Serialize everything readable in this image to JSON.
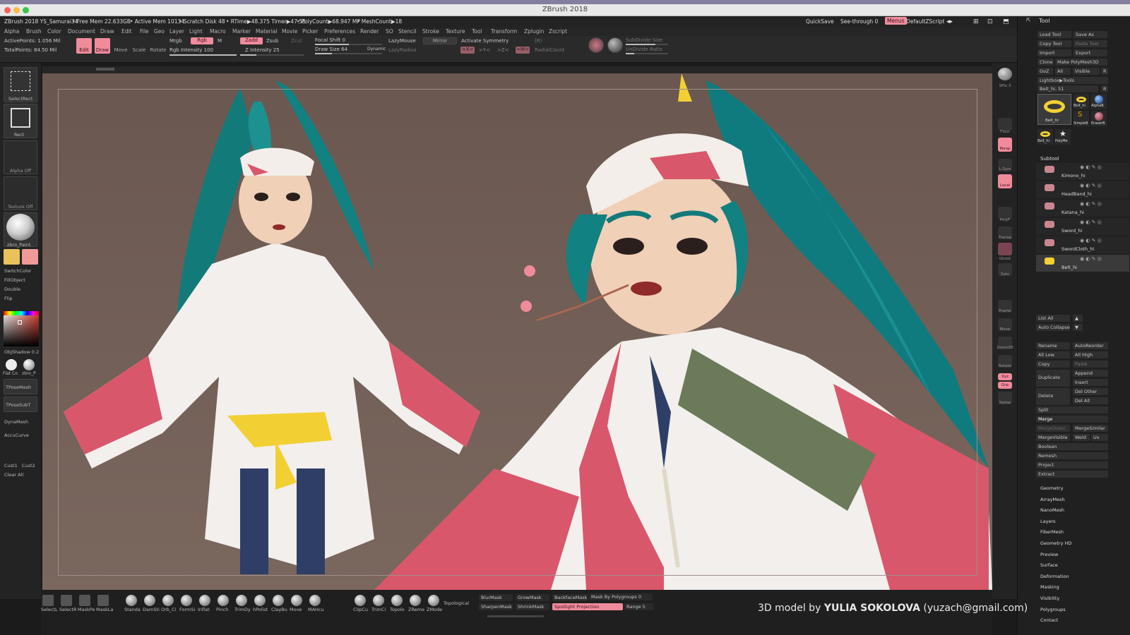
{
  "window": {
    "title": "ZBrush 2018"
  },
  "status": {
    "file": "ZBrush 2018 YS_Samurai34",
    "free_mem": "• Free Mem 22.633GB",
    "active_mem": "• Active Mem 10134",
    "scratch": "• Scratch Disk 48",
    "rtime": "• RTime▶48.375 Timer▶47.55",
    "polycount": "• PolyCount▶68.947 MP",
    "meshcount": "• MeshCount▶18",
    "quicksave": "QuickSave",
    "seethrough": "See-through  0",
    "menus": "Menus",
    "zscript": "DefaultZScript"
  },
  "menubar": [
    "Alpha",
    "Brush",
    "Color",
    "Document",
    "Draw",
    "Edit",
    "File",
    "Geo",
    "Layer",
    "Light",
    "Macro",
    "Marker",
    "Material",
    "Movie",
    "Picker",
    "Preferences",
    "Render",
    "SO",
    "Stencil",
    "Stroke",
    "Texture",
    "Tool",
    "Transform",
    "Zplugin",
    "Zscript"
  ],
  "shelf": {
    "active_points": "ActivePoints: 1.056 Mil",
    "total_points": "TotalPoints: 84.50 Mil",
    "edit": "Edit",
    "draw": "Draw",
    "move": "Move",
    "scale": "Scale",
    "rotate": "Rotate",
    "mrgb": "Mrgb",
    "rgb": "Rgb",
    "m": "M",
    "rgb_intensity": "Rgb Intensity 100",
    "zadd": "Zadd",
    "zsub": "Zsub",
    "zcut": "Zcut",
    "z_intensity": "Z Intensity 25",
    "focal_shift": "Focal Shift 0",
    "draw_size": "Draw Size 64",
    "dynamic": "Dynamic",
    "lazymouse": "LazyMouse",
    "lazyradius": "LazyRadius",
    "mirror": "Mirror",
    "activate_symmetry": "Activate Symmetry",
    "sym_x": ">X<",
    "sym_y": ">Y<",
    "sym_z": ">Z<",
    "sym_m": ">M<",
    "sym_r": "(R)",
    "radialcount": "RadialCount",
    "subdivide_size": "SubDivide Size",
    "undivide_ratio": "UnDivide Ratio"
  },
  "left": {
    "selectrect": "SelectRect",
    "rect": "Rect",
    "alpha_off": "Alpha Off",
    "texture_off": "Texture Off",
    "material": "zbro_Paint",
    "switchcolor": "SwitchColor",
    "fillobject": "FillObject",
    "double": "Double",
    "flip": "Flip",
    "objshadow": "ObjShadow  0.2",
    "flatco": "Flat Co",
    "zbro_p": "zbro_P",
    "tposemesh": "TPoseMesh",
    "tposesubt": "TPoseSubT",
    "dynamesh": "DynaMesh",
    "accucurve": "AccuCurve",
    "cust1": "Cust1",
    "cust2": "Cust2",
    "clearall": "Clear All",
    "primary_color": "#e9c35a",
    "secondary_color": "#ee9a98"
  },
  "right": {
    "bpr": "BPR",
    "spix": "SPix 3",
    "floor": "Floor",
    "persp": "Persp",
    "lsym": "L.Sym",
    "local": "Local",
    "polyf": "PolyF",
    "transp": "Transp",
    "ghost": "Ghost",
    "solo": "Solo",
    "frame": "Frame",
    "move": "Move",
    "zoom3d": "Zoom3D",
    "rotate": "Rotate",
    "xyz": "Xyz",
    "grp": "Grp",
    "xpose": "Xpose"
  },
  "tool": {
    "header": "Tool",
    "load_tool": "Load Tool",
    "save_as": "Save As",
    "copy_tool": "Copy Tool",
    "paste_tool": "Paste Tool",
    "import": "Import",
    "export": "Export",
    "clone": "Clone",
    "make_polymesh": "Make PolyMesh3D",
    "goz": "GoZ",
    "all": "All",
    "visible": "Visible",
    "r": "R",
    "lightbox": "Lightbox▶Tools",
    "current": "Belt_hi. 51",
    "current_r": "R",
    "thumbs": [
      "Belt_hi",
      "AlphaB",
      "SimpleB",
      "EraserB",
      "Belt_hi",
      "PolyMe"
    ],
    "subtool_header": "Subtool",
    "subtools": [
      "Kimono_hi",
      "HeadBand_hi",
      "Katana_hi",
      "Sword_hi",
      "SwordCloth_hi",
      "Belt_hi"
    ],
    "list_all": "List All",
    "auto_collapse": "Auto Collapse",
    "rename": "Rename",
    "autoreorder": "AutoReorder",
    "all_low": "All Low",
    "all_high": "All High",
    "copy": "Copy",
    "paste": "Paste",
    "duplicate": "Duplicate",
    "append": "Append",
    "insert": "Insert",
    "delete": "Delete",
    "del_other": "Del Other",
    "del_all": "Del All",
    "split": "Split",
    "merge": "Merge",
    "mergedown": "MergeDown",
    "mergesimilar": "MergeSimilar",
    "mergevisible": "MergeVisible",
    "weld": "Weld",
    "uv": "Uv",
    "boolean": "Boolean",
    "remesh": "Remesh",
    "project": "Project",
    "extract": "Extract",
    "sections": [
      "Geometry",
      "ArrayMesh",
      "NanoMesh",
      "Layers",
      "FiberMesh",
      "Geometry HD",
      "Preview",
      "Surface",
      "Deformation",
      "Masking",
      "Visibility",
      "Polygroups",
      "Contact"
    ]
  },
  "bottom": {
    "brushes": [
      "SelectL",
      "SelectR",
      "MaskPe",
      "MaskLa",
      "Standa",
      "DamSti",
      "Orb_Ci",
      "FormSi",
      "Inflat",
      "Pinch",
      "TrimDy",
      "hPolist",
      "ClayBu",
      "Move",
      "MAHcu",
      "ClipCu",
      "TrimCi",
      "Topolo",
      "ZReme",
      "ZMode"
    ],
    "topological": "Topological",
    "blurmask": "BlurMask",
    "growmask": "GrowMask",
    "backfacemask": "BackfaceMask",
    "mask_by_polygroups": "Mask By Polygroups 0",
    "sharpenmask": "SharpenMask",
    "shrinkmask": "ShrinkMask",
    "spotlight": "Spotlight Projection",
    "range": "Range 5"
  },
  "credit": {
    "prefix": "3D model by ",
    "name": "YULIA SOKOLOVA",
    "email": " (yuzach@gmail.com)"
  }
}
